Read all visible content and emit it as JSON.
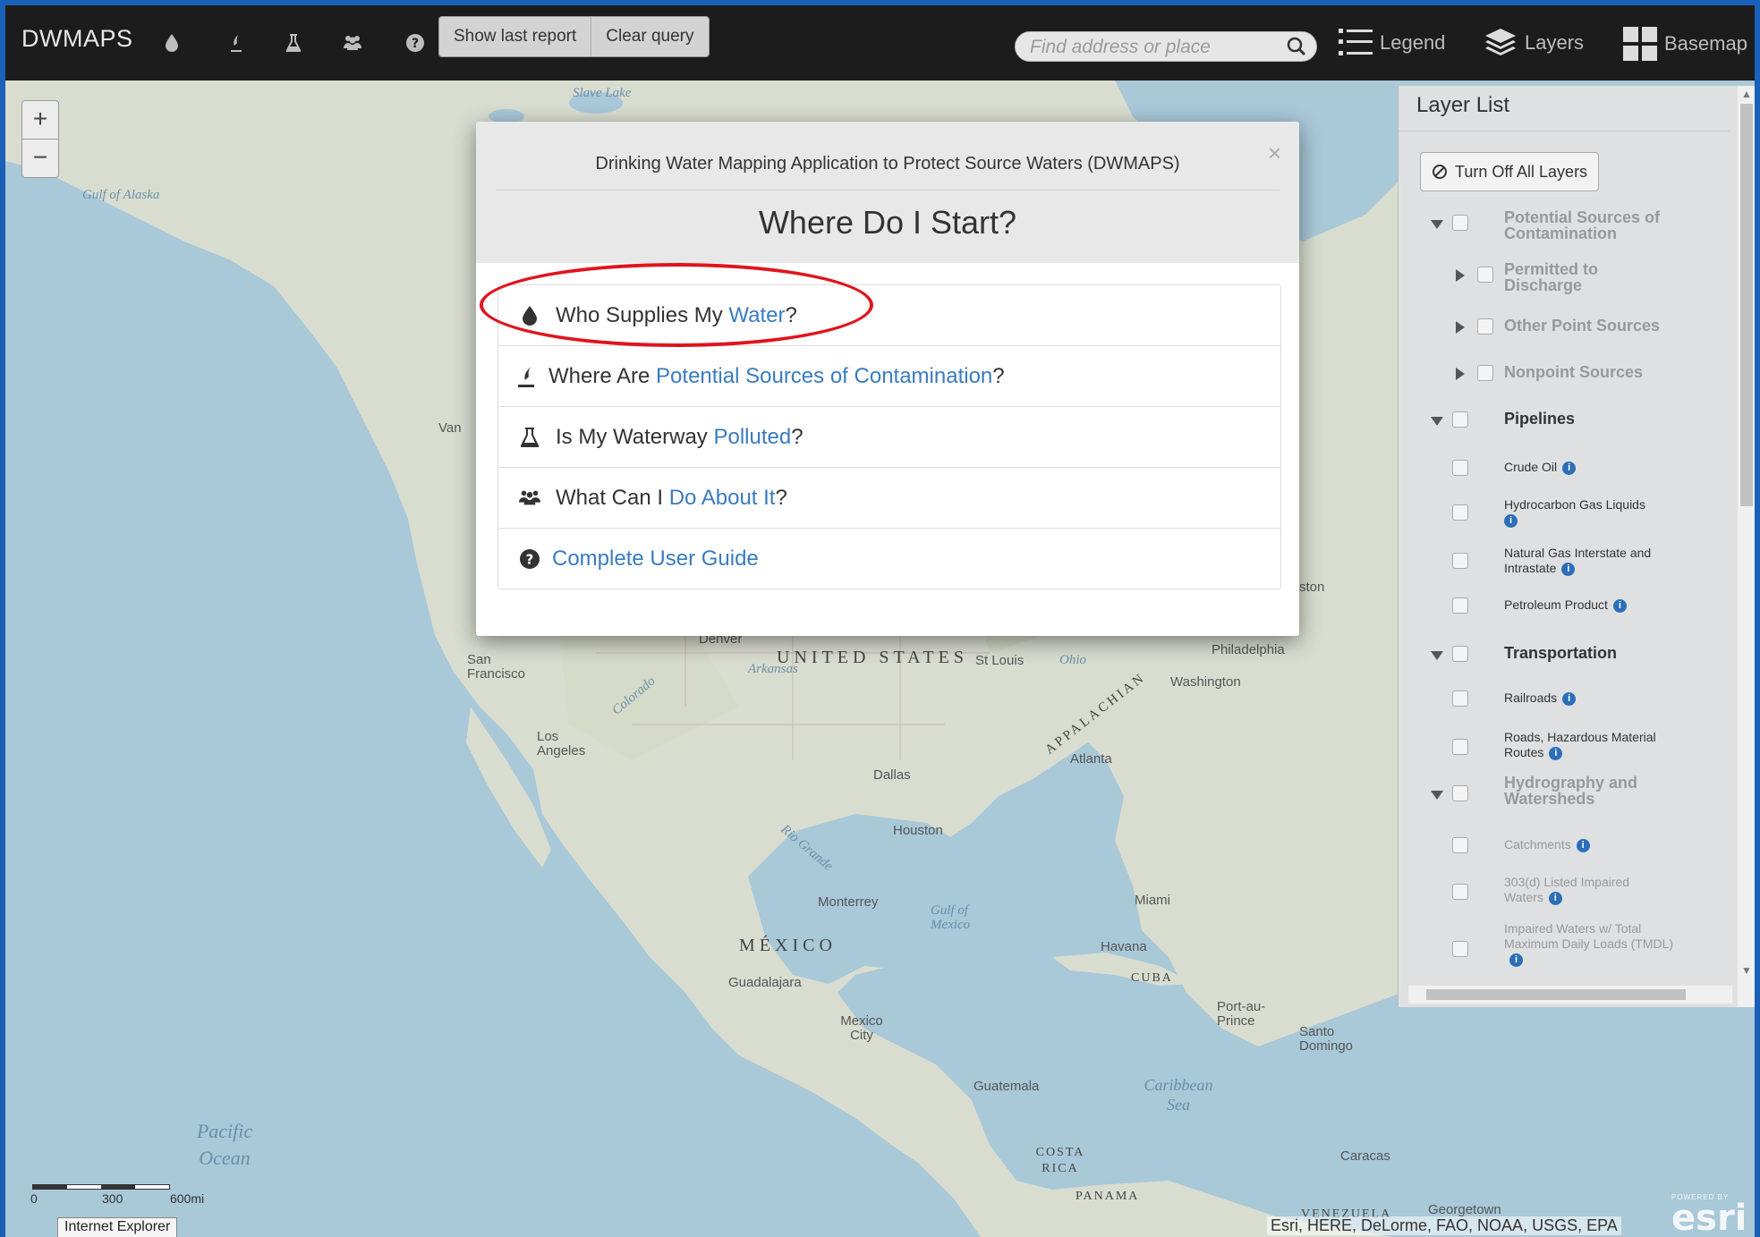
{
  "app": {
    "brand": "DWMAPS"
  },
  "toolbar": {
    "show_last_report": "Show last report",
    "clear_query": "Clear query",
    "search_placeholder": "Find address or place",
    "legend": "Legend",
    "layers": "Layers",
    "basemap": "Basemap"
  },
  "modal": {
    "subtitle": "Drinking Water Mapping Application to Protect Source Waters (DWMAPS)",
    "title": "Where Do I Start?",
    "close": "×",
    "items": [
      {
        "icon": "water-drop-icon",
        "prefix": "Who Supplies My ",
        "link": "Water",
        "suffix": "?",
        "highlighted": true
      },
      {
        "icon": "contamination-icon",
        "prefix": "Where Are ",
        "link": "Potential Sources of Contamination",
        "suffix": "?"
      },
      {
        "icon": "flask-icon",
        "prefix": "Is My Waterway ",
        "link": "Polluted",
        "suffix": "?"
      },
      {
        "icon": "people-icon",
        "prefix": "What Can I ",
        "link": "Do About It",
        "suffix": "?"
      },
      {
        "icon": "question-circle-icon",
        "prefix": "",
        "link": "Complete User Guide",
        "suffix": ""
      }
    ],
    "highlight_color": "#e0141e"
  },
  "layer_list": {
    "title": "Layer List",
    "turn_off_all": "Turn Off All Layers",
    "groups": [
      {
        "label": "Potential Sources of Contamination",
        "expanded": true,
        "dim": true
      },
      {
        "label": "Permitted to Discharge",
        "sub": true,
        "expanded": false
      },
      {
        "label": "Other Point Sources",
        "sub": true,
        "expanded": false
      },
      {
        "label": "Nonpoint Sources",
        "sub": true,
        "expanded": false
      },
      {
        "label": "Pipelines",
        "expanded": true
      },
      {
        "label": "Crude Oil",
        "leaf": true
      },
      {
        "label": "Hydrocarbon Gas Liquids",
        "leaf": true
      },
      {
        "label": "Natural Gas Interstate and Intrastate",
        "leaf": true
      },
      {
        "label": "Petroleum Product",
        "leaf": true
      },
      {
        "label": "Transportation",
        "expanded": true
      },
      {
        "label": "Railroads",
        "leaf": true
      },
      {
        "label": "Roads, Hazardous Material Routes",
        "leaf": true
      },
      {
        "label": "Hydrography and Watersheds",
        "expanded": true,
        "dim": true
      },
      {
        "label": "Catchments",
        "leaf": true,
        "dim": true
      },
      {
        "label": "303(d) Listed Impaired Waters",
        "leaf": true,
        "dim": true
      },
      {
        "label": "Impaired Waters w/ Total Maximum Daily Loads (TMDL)",
        "leaf": true,
        "dim": true
      }
    ]
  },
  "map": {
    "labels": {
      "gulf_alaska": "Gulf of Alaska",
      "united_states": "UNITED STATES",
      "mexico": "MÉXICO",
      "cuba": "CUBA",
      "costa_rica": "COSTA RICA",
      "panama": "PANAMA",
      "venezuela": "VENEZUELA",
      "pacific": "Pacific Ocean",
      "caribbean": "Caribbean Sea",
      "gulf_mexico": "Gulf of Mexico",
      "appalachian": "APPALACHIAN",
      "arkansas": "Arkansas",
      "colorado": "Colorado",
      "rio_grande": "Rio Grande",
      "ohio": "Ohio",
      "slave_lake": "Slave Lake",
      "san_francisco": "San Francisco",
      "los_angeles": "Los Angeles",
      "denver": "Denver",
      "st_louis": "St Louis",
      "philadelphia": "Philadelphia",
      "washington": "Washington",
      "atlanta": "Atlanta",
      "dallas": "Dallas",
      "houston": "Houston",
      "monterrey": "Monterrey",
      "miami": "Miami",
      "havana": "Havana",
      "guadalajara": "Guadalajara",
      "mexico_city": "Mexico City",
      "port_au_prince": "Port-au-Prince",
      "santo_domingo": "Santo Domingo",
      "guatemala": "Guatemala",
      "caracas": "Caracas",
      "georgetown": "Georgetown",
      "boston_partial": "ston",
      "vancouver_partial": "Van"
    },
    "zoom_in": "+",
    "zoom_out": "−",
    "scale": {
      "s0": "0",
      "s1": "300",
      "s2": "600mi"
    },
    "attribution": "Esri, HERE, DeLorme, FAO, NOAA, USGS, EPA",
    "esri_powered": "POWERED BY",
    "esri_logo": "esri",
    "tooltip": "Internet Explorer"
  }
}
